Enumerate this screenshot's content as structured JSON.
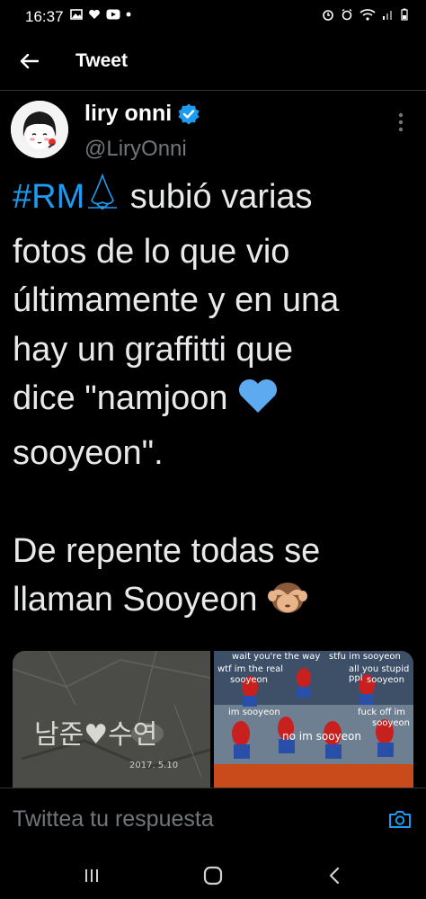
{
  "status_bar": {
    "time": "16:37"
  },
  "header": {
    "title": "Tweet",
    "back_icon": "arrow-left-icon"
  },
  "tweet": {
    "author_name": "liry onni",
    "author_handle": "@LiryOnni",
    "hashtag": "#RM",
    "text_part1": " subió varias\nfotos de lo que vio\núltimamente y en una\nhay un graffitti que\ndice \"namjoon ",
    "text_part2": "\nsooyeon\".\n\nDe repente todas se\nllaman Sooyeon ",
    "media": {
      "graffiti_text": "남준♥수연",
      "graffiti_date": "2017. 5.10",
      "meme_captions": [
        "wait you're the way",
        "stfu im sooyeon",
        "wtf im the real",
        "sooyeon",
        "all you stupid ppl",
        "sooyeon",
        "im sooyeon",
        "fuck off im",
        "sooyeon",
        "no im sooyeon"
      ]
    }
  },
  "reply": {
    "placeholder": "Twittea tu respuesta"
  },
  "colors": {
    "background": "#000000",
    "accent": "#1d9bf0",
    "text": "#e7e9ea",
    "muted": "#71767b"
  }
}
